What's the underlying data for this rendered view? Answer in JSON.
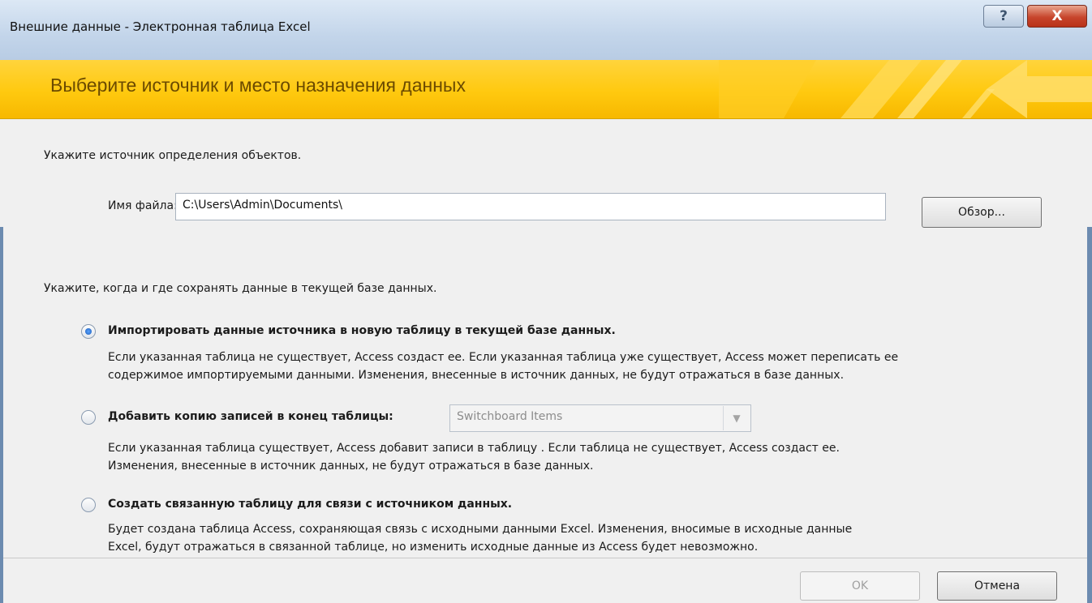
{
  "window": {
    "title": "Внешние данные - Электронная таблица Excel",
    "help_label": "?",
    "close_label": "X"
  },
  "banner": {
    "heading": "Выберите источник и место назначения данных"
  },
  "source": {
    "instruction": "Укажите источник определения объектов.",
    "filename_label": "Имя файла:",
    "filename_value": "C:\\Users\\Admin\\Documents\\",
    "browse_label": "Обзор..."
  },
  "storage": {
    "instruction": "Укажите, когда и где сохранять данные в текущей базе данных.",
    "options": [
      {
        "label": "Импортировать данные источника в новую таблицу в текущей базе данных.",
        "description_line1": "Если указанная таблица не существует, Access создаст ее. Если указанная таблица уже существует, Access может переписать ее",
        "description_line2": "содержимое импортируемыми данными. Изменения, внесенные в источник данных, не будут отражаться в базе данных.",
        "selected": true
      },
      {
        "label": "Добавить копию записей в конец таблицы:",
        "combo_value": "Switchboard Items",
        "description_line1": "Если указанная таблица существует, Access добавит записи в таблицу . Если таблица не существует, Access создаст ее.",
        "description_line2": "Изменения, внесенные в источник данных, не будут отражаться в базе данных.",
        "selected": false
      },
      {
        "label": "Создать связанную таблицу для связи с источником данных.",
        "description_line1": "Будет создана таблица Access, сохраняющая связь с исходными данными Excel. Изменения, вносимые в исходные данные",
        "description_line2": "Excel, будут отражаться в связанной таблице, но изменить исходные данные из Access будет невозможно.",
        "selected": false
      }
    ]
  },
  "footer": {
    "ok_label": "OK",
    "cancel_label": "Отмена"
  },
  "colors": {
    "banner": "#ffc90f",
    "heading_text": "#6b4a00",
    "close_button": "#c7452c"
  }
}
